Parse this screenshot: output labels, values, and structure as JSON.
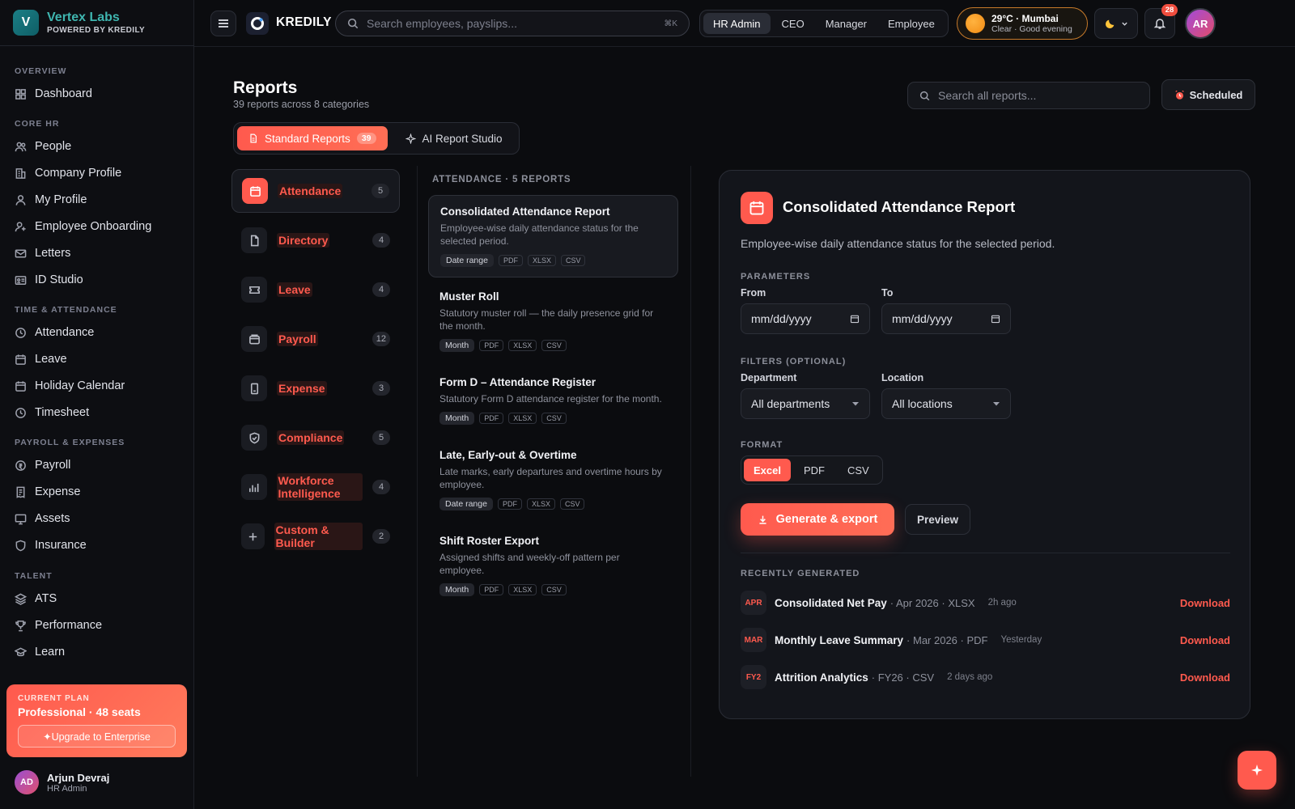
{
  "brand": {
    "logo_letter": "V",
    "name": "Vertex Labs",
    "sub": "POWERED BY KREDILY"
  },
  "sidebar": {
    "sections": [
      {
        "title": "OVERVIEW"
      },
      {
        "title": "CORE HR"
      },
      {
        "title": "TIME & ATTENDANCE"
      },
      {
        "title": "PAYROLL & EXPENSES"
      },
      {
        "title": "TALENT"
      }
    ],
    "items": [
      {
        "label": "Dashboard",
        "icon": "grid-icon"
      },
      {
        "label": "People",
        "icon": "people-icon"
      },
      {
        "label": "Company Profile",
        "icon": "building-icon"
      },
      {
        "label": "My Profile",
        "icon": "user-icon"
      },
      {
        "label": "Employee Onboarding",
        "icon": "user-plus-icon"
      },
      {
        "label": "Letters",
        "icon": "mail-icon"
      },
      {
        "label": "ID Studio",
        "icon": "id-card-icon"
      },
      {
        "label": "Attendance",
        "icon": "clock-icon"
      },
      {
        "label": "Leave",
        "icon": "calendar-icon"
      },
      {
        "label": "Holiday Calendar",
        "icon": "calendar-icon"
      },
      {
        "label": "Timesheet",
        "icon": "clock-icon"
      },
      {
        "label": "Payroll",
        "icon": "coin-icon"
      },
      {
        "label": "Expense",
        "icon": "receipt-icon"
      },
      {
        "label": "Assets",
        "icon": "monitor-icon"
      },
      {
        "label": "Insurance",
        "icon": "shield-icon"
      },
      {
        "label": "ATS",
        "icon": "layers-icon"
      },
      {
        "label": "Performance",
        "icon": "trophy-icon"
      },
      {
        "label": "Learn",
        "icon": "graduation-icon"
      }
    ],
    "plan": {
      "label": "CURRENT PLAN",
      "name": "Professional · 48 seats",
      "upgrade": "✦Upgrade to Enterprise"
    },
    "user": {
      "initials": "AD",
      "name": "Arjun Devraj",
      "role": "HR Admin"
    }
  },
  "topbar": {
    "app_name": "KREDILY",
    "search_placeholder": "Search employees, payslips...",
    "shortcut": "⌘K",
    "roles": [
      "HR Admin",
      "CEO",
      "Manager",
      "Employee"
    ],
    "active_role": "HR Admin",
    "weather": {
      "temp": "29°C · Mumbai",
      "sub": "Clear · Good evening"
    },
    "theme_icon": "moon-icon",
    "notifications": "28",
    "avatar": "AR"
  },
  "page": {
    "title": "Reports",
    "subtitle": "39 reports across 8 categories",
    "search_placeholder": "Search all reports...",
    "scheduled_label": "Scheduled",
    "tabs": [
      {
        "label": "Standard Reports",
        "count": "39"
      },
      {
        "label": "AI Report Studio"
      }
    ]
  },
  "categories": [
    {
      "label": "Attendance",
      "count": "5",
      "icon": "calendar-icon"
    },
    {
      "label": "Directory",
      "count": "4",
      "icon": "file-icon"
    },
    {
      "label": "Leave",
      "count": "4",
      "icon": "ticket-icon"
    },
    {
      "label": "Payroll",
      "count": "12",
      "icon": "wallet-icon"
    },
    {
      "label": "Expense",
      "count": "3",
      "icon": "receipt-icon"
    },
    {
      "label": "Compliance",
      "count": "5",
      "icon": "shield-check-icon"
    },
    {
      "label": "Workforce Intelligence",
      "count": "4",
      "icon": "bar-chart-icon"
    },
    {
      "label": "Custom & Builder",
      "count": "2",
      "icon": "plus-icon"
    }
  ],
  "report_list": {
    "heading": "ATTENDANCE · 5 REPORTS",
    "formats": [
      "PDF",
      "XLSX",
      "CSV"
    ],
    "items": [
      {
        "title": "Consolidated Attendance Report",
        "desc": "Employee-wise daily attendance status for the selected period.",
        "period": "Date range"
      },
      {
        "title": "Muster Roll",
        "desc": "Statutory muster roll — the daily presence grid for the month.",
        "period": "Month"
      },
      {
        "title": "Form D – Attendance Register",
        "desc": "Statutory Form D attendance register for the month.",
        "period": "Month"
      },
      {
        "title": "Late, Early-out & Overtime",
        "desc": "Late marks, early departures and overtime hours by employee.",
        "period": "Date range"
      },
      {
        "title": "Shift Roster Export",
        "desc": "Assigned shifts and weekly-off pattern per employee.",
        "period": "Month"
      }
    ]
  },
  "detail": {
    "title": "Consolidated Attendance Report",
    "desc": "Employee-wise daily attendance status for the selected period.",
    "parameters_label": "PARAMETERS",
    "from_label": "From",
    "to_label": "To",
    "from_value": "mm/dd/yyyy",
    "to_value": "mm/dd/yyyy",
    "filters_label": "FILTERS (OPTIONAL)",
    "department_label": "Department",
    "department_value": "All departments",
    "location_label": "Location",
    "location_value": "All locations",
    "format_label": "FORMAT",
    "formats": [
      "Excel",
      "PDF",
      "CSV"
    ],
    "active_format": "Excel",
    "generate_label": "Generate & export",
    "preview_label": "Preview",
    "recent_label": "RECENTLY GENERATED",
    "recent": [
      {
        "badge": "APR",
        "name": "Consolidated Net Pay",
        "meta": "· Apr 2026 · XLSX",
        "time": "2h ago",
        "action": "Download"
      },
      {
        "badge": "MAR",
        "name": "Monthly Leave Summary",
        "meta": "· Mar 2026 · PDF",
        "time": "Yesterday",
        "action": "Download"
      },
      {
        "badge": "FY2",
        "name": "Attrition Analytics",
        "meta": "· FY26 · CSV",
        "time": "2 days ago",
        "action": "Download"
      }
    ]
  },
  "colors": {
    "accent": "#ff5a4e",
    "brand_teal": "#3fb6b0",
    "bg": "#0b0c0f"
  }
}
